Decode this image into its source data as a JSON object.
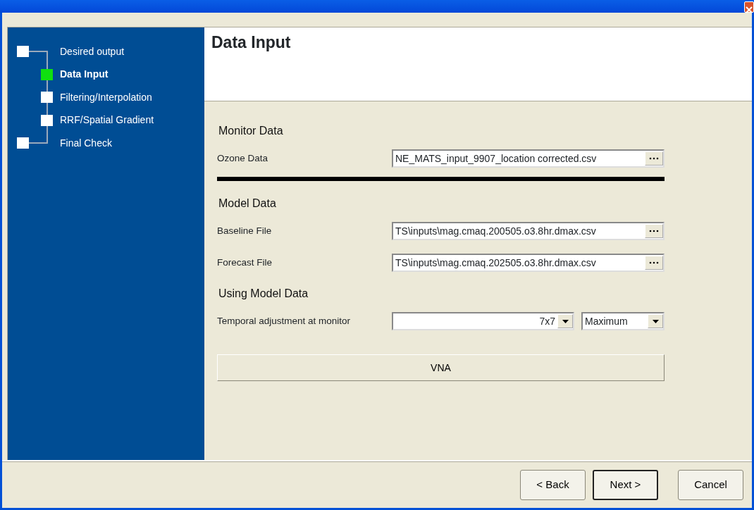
{
  "steps": [
    {
      "label": "Desired output",
      "selected": false,
      "children": [
        {
          "label": "Data Input",
          "selected": true
        },
        {
          "label": "Filtering/Interpolation",
          "selected": false
        },
        {
          "label": "RRF/Spatial Gradient",
          "selected": false
        }
      ]
    },
    {
      "label": "Final Check",
      "selected": false
    }
  ],
  "page_title": "Data Input",
  "sections": [
    {
      "heading": "Monitor Data",
      "divider_below": true,
      "fields": [
        {
          "label": "Ozone Data",
          "kind": "file",
          "value": "NE_MATS_input_9907_location corrected.csv"
        }
      ]
    },
    {
      "heading": "Model Data",
      "divider_below": false,
      "fields": [
        {
          "label": "Baseline File",
          "kind": "file",
          "value": "TS\\inputs\\mag.cmaq.200505.o3.8hr.dmax.csv"
        },
        {
          "label": "Forecast File",
          "kind": "file",
          "value": "TS\\inputs\\mag.cmaq.202505.o3.8hr.dmax.csv"
        }
      ]
    },
    {
      "heading": "Using Model Data",
      "divider_below": false,
      "fields": [
        {
          "label": "Temporal adjustment at monitor",
          "kind": "dropdowns",
          "dropdowns": [
            {
              "value": "7x7"
            },
            {
              "value": "Maximum"
            }
          ]
        }
      ]
    }
  ],
  "action_button": "VNA",
  "buttons": [
    {
      "label": "< Back",
      "default": false
    },
    {
      "label": "Next >",
      "default": true
    },
    {
      "label": "Cancel",
      "default": false
    }
  ]
}
